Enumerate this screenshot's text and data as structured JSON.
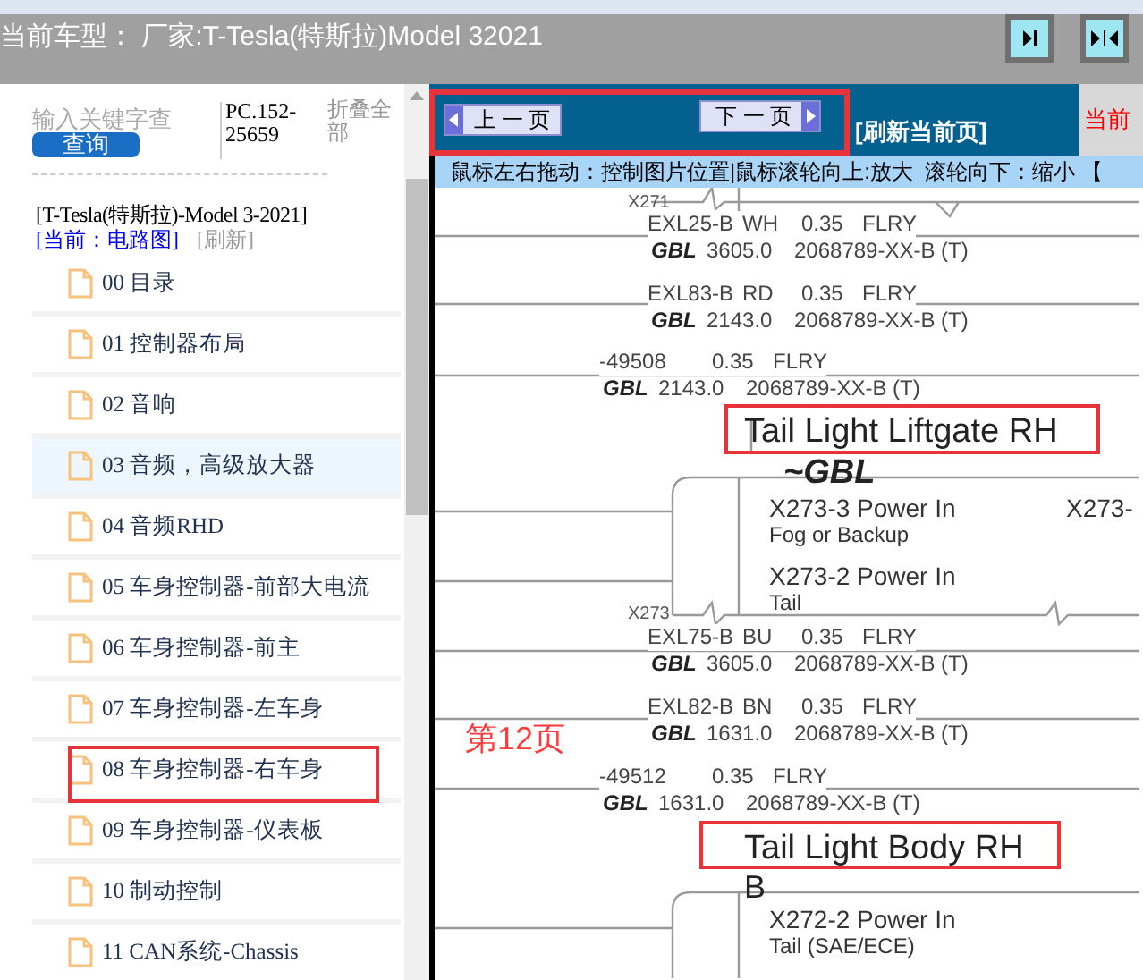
{
  "header": {
    "title": "当前车型： 厂家:T-Tesla(特斯拉)Model 32021"
  },
  "sidebar": {
    "search": {
      "placeholder": "输入关键字查"
    },
    "query_button": "查询",
    "code": "PC.152-25659",
    "collapse_all": "折叠全部",
    "model": "[T-Tesla(特斯拉)-Model 3-2021]",
    "current": "[当前：电路图]",
    "refresh": "[刷新]",
    "items": [
      {
        "label": "00 目录",
        "highlighted": false,
        "annotated": false
      },
      {
        "label": "01 控制器布局",
        "highlighted": false,
        "annotated": false
      },
      {
        "label": "02 音响",
        "highlighted": false,
        "annotated": false
      },
      {
        "label": "03 音频，高级放大器",
        "highlighted": true,
        "annotated": false
      },
      {
        "label": "04 音频RHD",
        "highlighted": false,
        "annotated": false
      },
      {
        "label": "05 车身控制器-前部大电流",
        "highlighted": false,
        "annotated": false
      },
      {
        "label": "06 车身控制器-前主",
        "highlighted": false,
        "annotated": false
      },
      {
        "label": "07 车身控制器-左车身",
        "highlighted": false,
        "annotated": false
      },
      {
        "label": "08 车身控制器-右车身",
        "highlighted": false,
        "annotated": true
      },
      {
        "label": "09 车身控制器-仪表板",
        "highlighted": false,
        "annotated": false
      },
      {
        "label": "10 制动控制",
        "highlighted": false,
        "annotated": false
      },
      {
        "label": "11 CAN系统-Chassis",
        "highlighted": false,
        "annotated": false
      }
    ]
  },
  "toolbar": {
    "prev_button": "上 一 页",
    "next_button": "下 一 页",
    "refresh": "[刷新当前页]",
    "notice": "当前",
    "hint": "鼠标左右拖动：控制图片位置|鼠标滚轮向上:放大  滚轮向下：缩小 【"
  },
  "diagram": {
    "page_label": "第12页",
    "connectors": [
      "X271",
      "X273"
    ],
    "wires": [
      {
        "code": "EXL25-B",
        "color_code": "WH",
        "gauge": "0.35",
        "type": "FLRY",
        "material": "GBL",
        "length": "3605.0",
        "part": "2068789-XX-B (T)"
      },
      {
        "code": "EXL83-B",
        "color_code": "RD",
        "gauge": "0.35",
        "type": "FLRY",
        "material": "GBL",
        "length": "2143.0",
        "part": "2068789-XX-B (T)"
      },
      {
        "code": "-49508",
        "gauge": "0.35",
        "type": "FLRY",
        "material": "GBL",
        "length": "2143.0",
        "part": "2068789-XX-B (T)"
      },
      {
        "code": "EXL75-B",
        "color_code": "BU",
        "gauge": "0.35",
        "type": "FLRY",
        "material": "GBL",
        "length": "3605.0",
        "part": "2068789-XX-B (T)"
      },
      {
        "code": "EXL82-B",
        "color_code": "BN",
        "gauge": "0.35",
        "type": "FLRY",
        "material": "GBL",
        "length": "1631.0",
        "part": "2068789-XX-B (T)"
      },
      {
        "code": "-49512",
        "gauge": "0.35",
        "type": "FLRY",
        "material": "GBL",
        "length": "1631.0",
        "part": "2068789-XX-B (T)"
      }
    ],
    "components": [
      {
        "name": "Tail Light Liftgate RH",
        "suffix": "~GBL",
        "annotated": true
      },
      {
        "name": "Tail Light Body RH",
        "suffix": "B",
        "annotated": true
      }
    ],
    "pins": [
      {
        "name": "X273-3 Power In",
        "function": "Fog or Backup"
      },
      {
        "name": "X273-2 Power In",
        "function": "Tail"
      },
      {
        "name": "X272-2 Power In",
        "function": "Tail (SAE/ECE)"
      }
    ],
    "pin_cut": "X273-"
  }
}
